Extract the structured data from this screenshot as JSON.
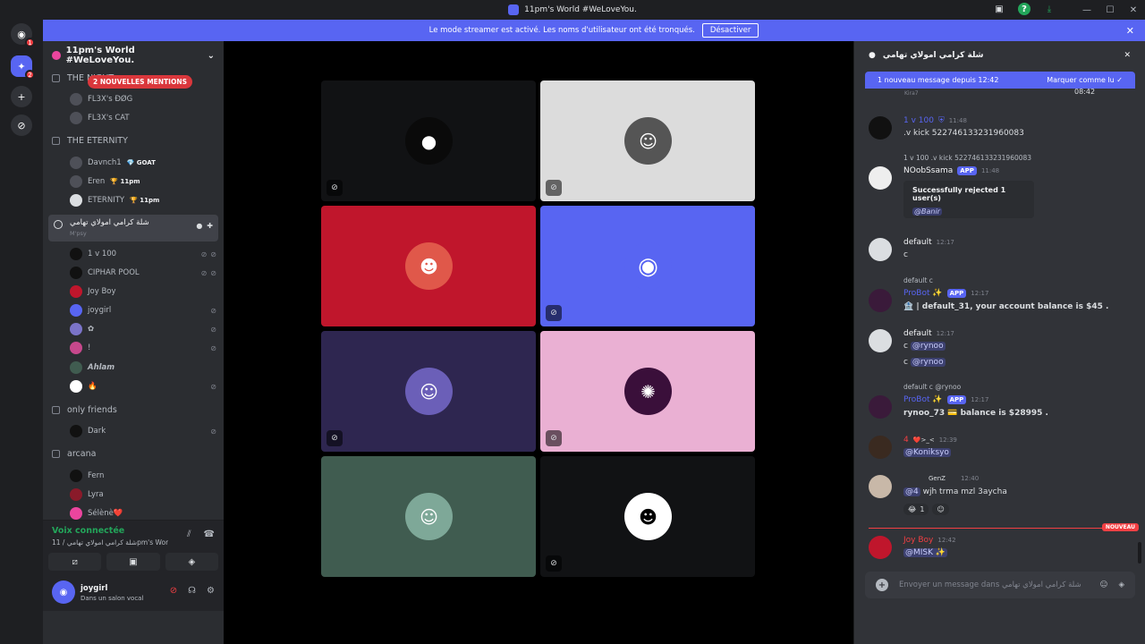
{
  "titlebar": {
    "title": "11pm's World #WeLoveYou."
  },
  "banner": {
    "text": "Le mode streamer est activé. Les noms d'utilisateur ont été tronqués.",
    "button": "Désactiver"
  },
  "rail": {
    "badges": [
      "1",
      "2"
    ]
  },
  "server": {
    "name": "11pm's World #WeLoveYou.",
    "mentions": "2 NOUVELLES MENTIONS"
  },
  "channels": {
    "cat1": "THE NIGHT",
    "top_users": [
      "FL3X's ĐØG",
      "FL3X's CAT"
    ],
    "cat2": "THE ETERNITY",
    "eternity_users": [
      {
        "name": "Davnch1",
        "tag": "💎 GOAT"
      },
      {
        "name": "Eren",
        "tag": "🏆 11pm"
      },
      {
        "name": "ETERNITY",
        "tag": "🏆 11pm"
      }
    ],
    "voice": {
      "name": "شلة كرامي امولاي تهامي",
      "sub": "M'psy"
    },
    "voice_users": [
      "1 v 100",
      "CIPHAR POOL",
      "Joy Boy",
      "joygirl",
      "✿",
      "!",
      "Ahlam",
      "🔥"
    ],
    "cat3": "only friends",
    "friends_users": [
      "Dark"
    ],
    "cat4": "arcana",
    "arcana_users": [
      "Fern",
      "Lyra",
      "Sélènè❤️"
    ]
  },
  "voice_panel": {
    "status": "Voix connectée",
    "location": "شلة كرامي امولاي تهامي / 11pm's World #WeLov..."
  },
  "user_panel": {
    "name": "joygirl",
    "status": "Dans un salon vocal"
  },
  "colors": {
    "blurple": "#5865f2",
    "red_tile": "#c0162c",
    "purple_tile": "#2e2650",
    "pink_tile": "#eab0d3",
    "green_tile": "#405c50"
  },
  "chat": {
    "title": "شلة كرامي امولاي تهامي",
    "new_bar": "1 nouveau message depuis 12:42",
    "mark_read": "Marquer comme lu",
    "peek": {
      "name": "Kira7",
      "time": "08:42"
    },
    "messages": {
      "m1": {
        "name": "1 v 100",
        "time": "11:48",
        "text": ".v kick 522746133231960083"
      },
      "m2": {
        "reply": "1 v 100 .v kick 522746133231960083",
        "name": "NOobSsama",
        "badge": "APP",
        "time": "11:48",
        "embed_title": "Successfully rejected 1 user(s)",
        "embed_mention": "@Banir"
      },
      "m3": {
        "name": "default",
        "time": "12:17",
        "text": "c"
      },
      "m4": {
        "reply": "default c",
        "name": "ProBot ✨",
        "badge": "APP",
        "time": "12:17",
        "text": "🏦 | default_31, your account balance is $45 ."
      },
      "m5": {
        "name": "default",
        "time": "12:17",
        "mention": "@rynoo",
        "prefix": "c"
      },
      "m6": {
        "reply": "default c @rynoo",
        "name": "ProBot ✨",
        "badge": "APP",
        "time": "12:17",
        "text": "rynoo_73 💳 balance is $28995 ."
      },
      "m7": {
        "name": "4",
        "tag": "❤️>_<",
        "time": "12:39",
        "mention": "@Koniksyo"
      },
      "m8": {
        "tag": "GenZ",
        "time": "12:40",
        "mention": "@4",
        "text": "wjh trma mzl 3aycha",
        "reaction_count": "1"
      },
      "m9": {
        "name": "Joy Boy",
        "time": "12:42",
        "mention": "@MISK ✨"
      }
    },
    "divider": "NOUVEAU",
    "composer_placeholder": "Envoyer un message dans شلة كرامي امولاي تهامي"
  }
}
